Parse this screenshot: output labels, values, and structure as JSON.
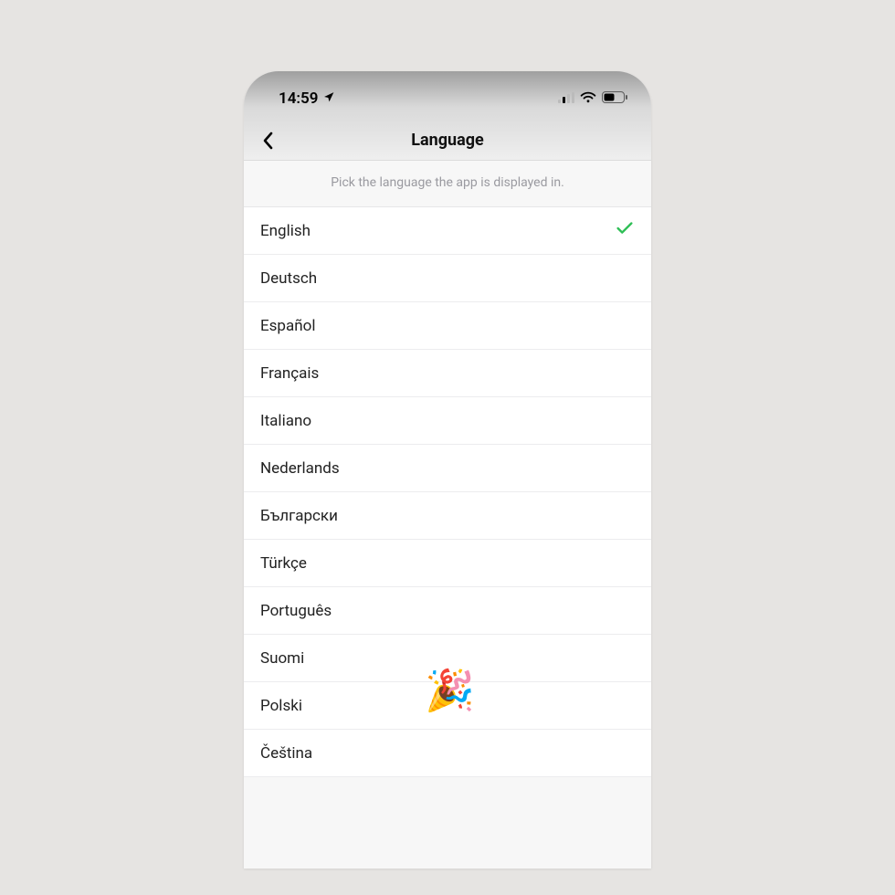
{
  "status": {
    "time": "14:59"
  },
  "nav": {
    "title": "Language"
  },
  "subheader": "Pick the language the app is displayed in.",
  "languages": [
    {
      "label": "English",
      "selected": true
    },
    {
      "label": "Deutsch",
      "selected": false
    },
    {
      "label": "Español",
      "selected": false
    },
    {
      "label": "Français",
      "selected": false
    },
    {
      "label": "Italiano",
      "selected": false
    },
    {
      "label": "Nederlands",
      "selected": false
    },
    {
      "label": "Български",
      "selected": false
    },
    {
      "label": "Türkçe",
      "selected": false
    },
    {
      "label": "Português",
      "selected": false
    },
    {
      "label": "Suomi",
      "selected": false
    },
    {
      "label": "Polski",
      "selected": false
    },
    {
      "label": "Čeština",
      "selected": false
    }
  ],
  "overlay": {
    "emoji": "🎉"
  }
}
